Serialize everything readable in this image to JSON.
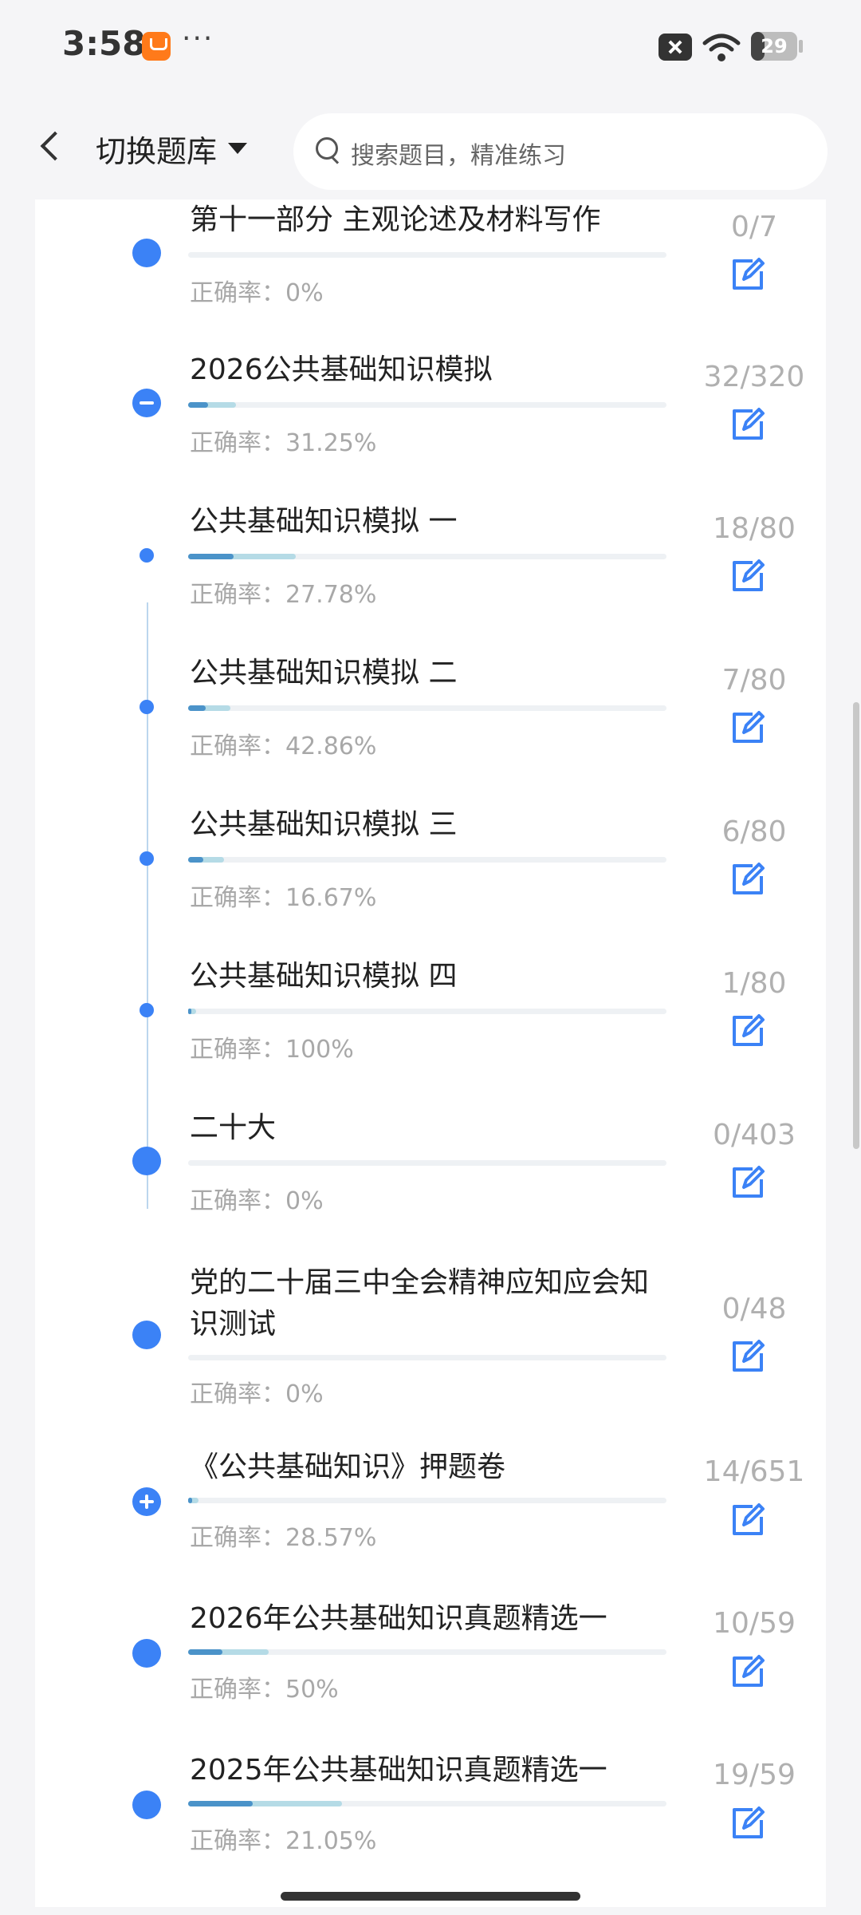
{
  "status_bar": {
    "time": "3:58",
    "dots": "···",
    "battery": "29",
    "battery_level_percent": 29
  },
  "header": {
    "title": "切换题库",
    "search_placeholder": "搜索题目，精准练习"
  },
  "items": [
    {
      "title": "第十一部分 主观论述及材料写作",
      "accuracy": "正确率：0%",
      "count": "0/7",
      "progress": 0,
      "node": "big"
    },
    {
      "title": "2026公共基础知识模拟",
      "accuracy": "正确率：31.25%",
      "count": "32/320",
      "progress": 0.1,
      "node": "collapse"
    },
    {
      "title": "公共基础知识模拟 一",
      "accuracy": "正确率：27.78%",
      "count": "18/80",
      "progress": 0.225,
      "node": "small"
    },
    {
      "title": "公共基础知识模拟 二",
      "accuracy": "正确率：42.86%",
      "count": "7/80",
      "progress": 0.0875,
      "node": "small"
    },
    {
      "title": "公共基础知识模拟 三",
      "accuracy": "正确率：16.67%",
      "count": "6/80",
      "progress": 0.075,
      "node": "small"
    },
    {
      "title": "公共基础知识模拟 四",
      "accuracy": "正确率：100%",
      "count": "1/80",
      "progress": 0.0125,
      "node": "small"
    },
    {
      "title": "二十大",
      "accuracy": "正确率：0%",
      "count": "0/403",
      "progress": 0,
      "node": "big"
    },
    {
      "title": "党的二十届三中全会精神应知应会知识测试",
      "accuracy": "正确率：0%",
      "count": "0/48",
      "progress": 0,
      "node": "big"
    },
    {
      "title": "《公共基础知识》押题卷",
      "accuracy": "正确率：28.57%",
      "count": "14/651",
      "progress": 0.0215,
      "node": "expand"
    },
    {
      "title": "2026年公共基础知识真题精选一",
      "accuracy": "正确率：50%",
      "count": "10/59",
      "progress": 0.169,
      "node": "big"
    },
    {
      "title": "2025年公共基础知识真题精选一",
      "accuracy": "正确率：21.05%",
      "count": "19/59",
      "progress": 0.322,
      "node": "big"
    }
  ]
}
